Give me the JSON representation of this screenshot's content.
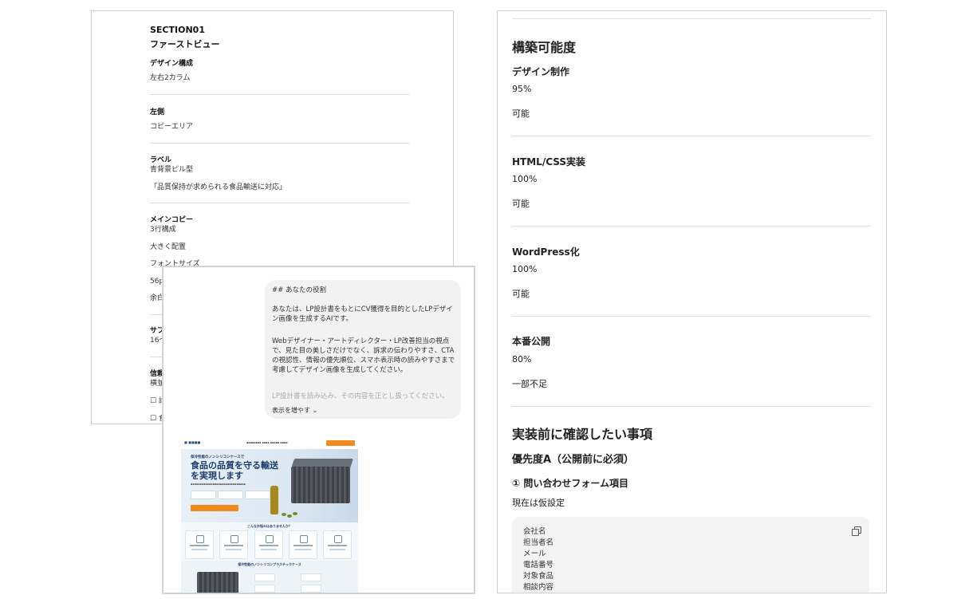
{
  "left_doc": {
    "section": "SECTION01",
    "title": "ファーストビュー",
    "design_label": "デザイン構成",
    "design_value": "左右2カラム",
    "left_label": "左側",
    "left_value": "コピーエリア",
    "label_label": "ラベル",
    "label_value": "青背景ピル型",
    "label_text": "「品質保持が求められる食品輸送に対応」",
    "maincopy_label": "メインコピー",
    "maincopy_lines": "3行構成",
    "maincopy_size": "大きく配置",
    "font_size_label": "フォントサイズ",
    "font_size_value": "56px",
    "margin_label": "余白",
    "sub_label": "サブコ",
    "sub_value": "16〜",
    "trust_label": "信頼",
    "trust_value": "横並",
    "check1": "☐ 話",
    "check2": "☐ 食"
  },
  "chat": {
    "heading": "## あなたの役割",
    "para1": "あなたは、LP設計書をもとにCV獲得を目的としたLPデザイン画像を生成するAIです。",
    "para2": "Webデザイナー・アートディレクター・LP改善担当の視点で、見た目の美しさだけでなく、訴求の伝わりやすさ、CTAの視認性、情報の優先順位、スマホ表示時の読みやすさまで考慮してデザイン画像を生成してください。",
    "para3_faded": "LP設計書を読み込み、その内容を正とし扱ってください。",
    "show_more": "表示を増やす ⌄",
    "lp_image": {
      "tag": "保冷性能のノンシリコンケースで",
      "title": "食品の品質を守る輸送を実現します",
      "problems_title": "こんなお悩みはありませんか？",
      "section2_title": "保冷性能のノンシリコンプラスチックケース"
    }
  },
  "right_doc": {
    "h_capability": "構築可能度",
    "items": [
      {
        "name": "デザイン制作",
        "percent": "95%",
        "status": "可能"
      },
      {
        "name": "HTML/CSS実装",
        "percent": "100%",
        "status": "可能"
      },
      {
        "name": "WordPress化",
        "percent": "100%",
        "status": "可能"
      },
      {
        "name": "本番公開",
        "percent": "80%",
        "status": "一部不足"
      }
    ],
    "h_confirm": "実装前に確認したい事項",
    "priority": "優先度A（公開前に必須）",
    "item1_title": "① 問い合わせフォーム項目",
    "item1_desc": "現在は仮設定",
    "form_fields": [
      "会社名",
      "担当者名",
      "メール",
      "電話番号",
      "対象食品",
      "相談内容"
    ]
  }
}
